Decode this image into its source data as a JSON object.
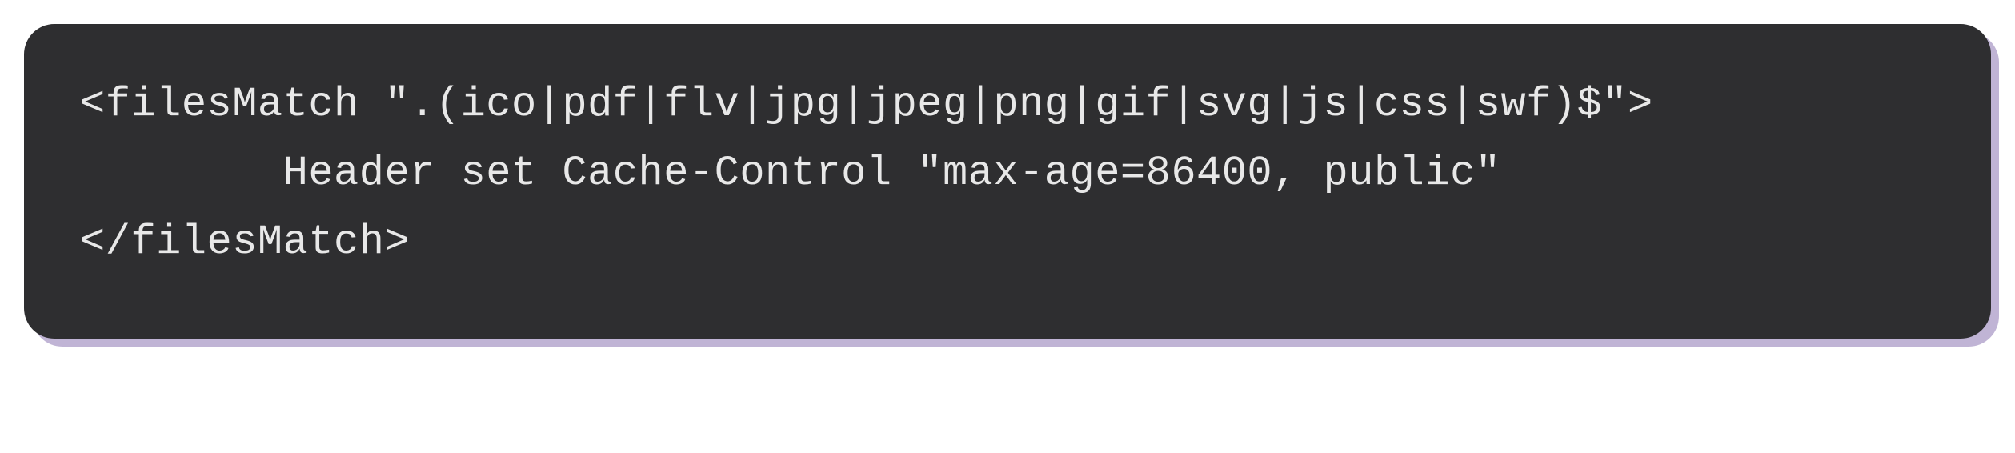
{
  "code": {
    "line1": "<filesMatch \".(ico|pdf|flv|jpg|jpeg|png|gif|svg|js|css|swf)$\">",
    "line2": "        Header set Cache-Control \"max-age=86400, public\"",
    "line3": "</filesMatch>"
  }
}
